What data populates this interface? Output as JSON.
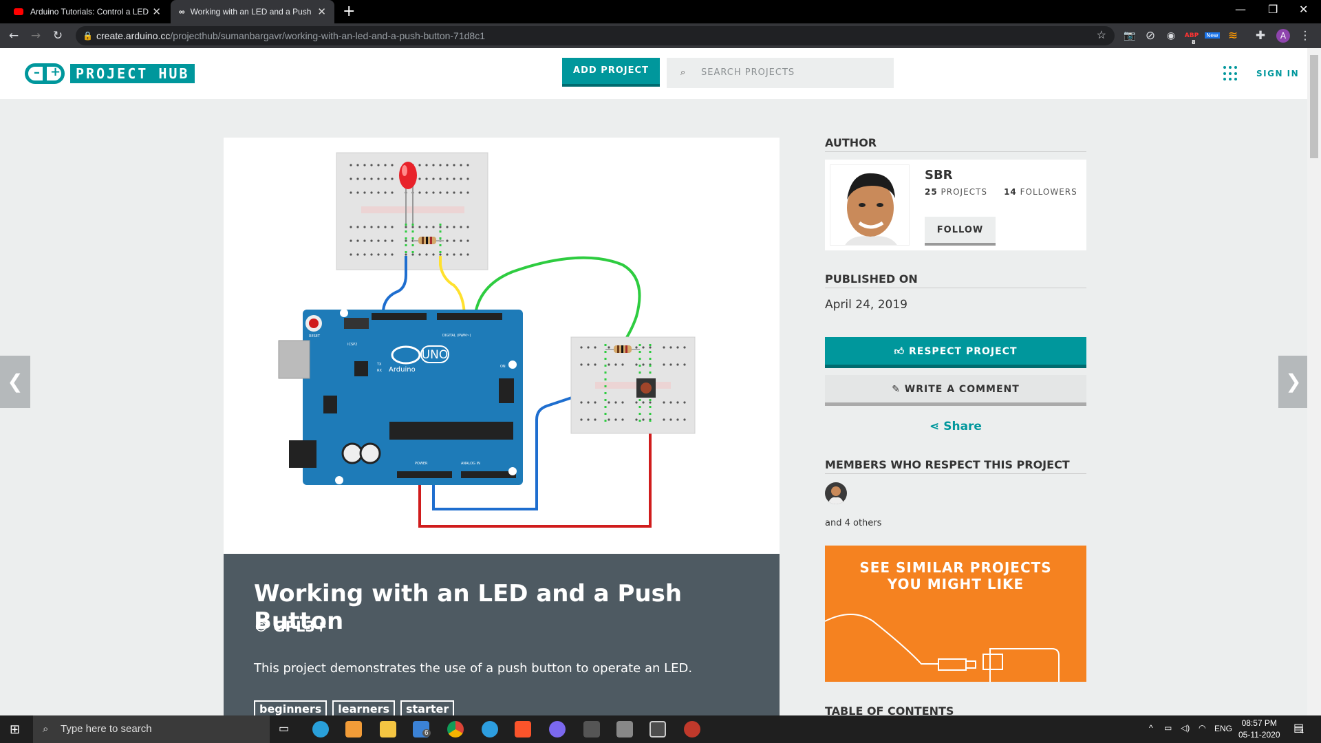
{
  "browser": {
    "tabs": [
      {
        "title": "Arduino Tutorials: Control a LED",
        "icon": "youtube-icon"
      },
      {
        "title": "Working with an LED and a Push",
        "icon": "arduino-icon"
      }
    ],
    "url_host": "create.arduino.cc",
    "url_path": "/projecthub/sumanbargavr/working-with-an-led-and-a-push-button-71d8c1",
    "ext_badges": {
      "abp": "8",
      "new": "New"
    },
    "profile_initial": "A"
  },
  "header": {
    "logo_text": "PROJECT HUB",
    "add_project": "ADD PROJECT",
    "search_placeholder": "SEARCH PROJECTS",
    "sign_in": "SIGN IN"
  },
  "project": {
    "title": "Working with an LED and a Push Button",
    "license": "© GPL3+",
    "description": "This project demonstrates the use of a push button to operate an LED.",
    "tags": [
      "beginners",
      "learners",
      "starter"
    ]
  },
  "sidebar": {
    "author_heading": "AUTHOR",
    "author_name": "SBR",
    "projects_count": "25",
    "projects_label": "PROJECTS",
    "followers_count": "14",
    "followers_label": "FOLLOWERS",
    "follow": "FOLLOW",
    "published_heading": "PUBLISHED ON",
    "published_date": "April 24, 2019",
    "respect": "RESPECT PROJECT",
    "comment": "WRITE A COMMENT",
    "share": "Share",
    "members_heading": "MEMBERS WHO RESPECT THIS PROJECT",
    "others": "and 4 others",
    "similar_line1": "SEE SIMILAR PROJECTS",
    "similar_line2": "YOU MIGHT LIKE",
    "toc_heading": "TABLE OF CONTENTS"
  },
  "board_labels": {
    "uno": "UNO",
    "arduino": "Arduino",
    "digital": "DIGITAL (PWM~)",
    "power": "POWER",
    "analog": "ANALOG IN",
    "reset": "RESET",
    "icsp": "ICSP2",
    "on": "ON",
    "tx": "TX",
    "rx": "RX"
  },
  "taskbar": {
    "search_placeholder": "Type here to search",
    "mail_badge": "6",
    "lang": "ENG",
    "time": "08:57 PM",
    "date": "05-11-2020",
    "notif_count": "4"
  },
  "colors": {
    "accent": "#00979c",
    "orange": "#f58220",
    "panel": "#4e5a62"
  }
}
